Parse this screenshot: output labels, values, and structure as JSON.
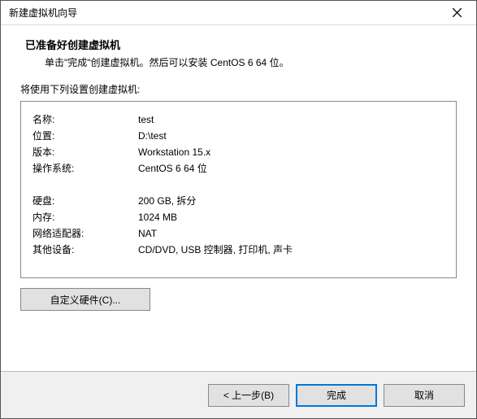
{
  "titlebar": {
    "title": "新建虚拟机向导"
  },
  "header": {
    "title": "已准备好创建虚拟机",
    "sub": "单击\"完成\"创建虚拟机。然后可以安装 CentOS 6 64 位。"
  },
  "body": {
    "caption": "将使用下列设置创建虚拟机:",
    "rows_a": [
      {
        "label": "名称:",
        "value": "test"
      },
      {
        "label": "位置:",
        "value": "D:\\test"
      },
      {
        "label": "版本:",
        "value": "Workstation 15.x"
      },
      {
        "label": "操作系统:",
        "value": "CentOS 6 64 位"
      }
    ],
    "rows_b": [
      {
        "label": "硬盘:",
        "value": "200 GB, 拆分"
      },
      {
        "label": "内存:",
        "value": "1024 MB"
      },
      {
        "label": "网络适配器:",
        "value": "NAT"
      },
      {
        "label": "其他设备:",
        "value": "CD/DVD, USB 控制器, 打印机, 声卡"
      }
    ],
    "customize_btn": "自定义硬件(C)..."
  },
  "footer": {
    "back": "< 上一步(B)",
    "finish": "完成",
    "cancel": "取消"
  }
}
